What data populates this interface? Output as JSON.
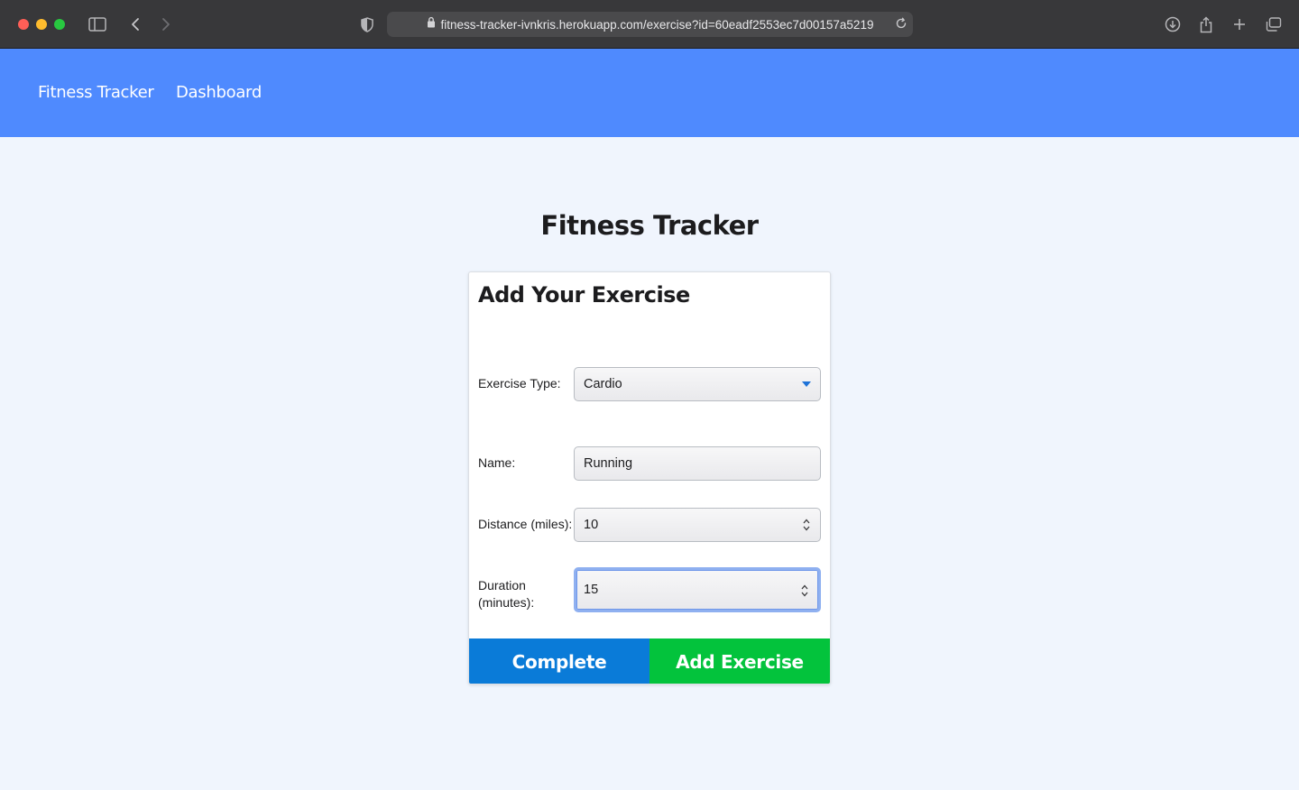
{
  "browser": {
    "url": "fitness-tracker-ivnkris.herokuapp.com/exercise?id=60eadf2553ec7d00157a5219"
  },
  "nav": {
    "brand": "Fitness Tracker",
    "dashboard": "Dashboard"
  },
  "page": {
    "title": "Fitness Tracker"
  },
  "form": {
    "heading": "Add Your Exercise",
    "exercise_type": {
      "label": "Exercise Type:",
      "value": "Cardio"
    },
    "name": {
      "label": "Name:",
      "value": "Running"
    },
    "distance": {
      "label": "Distance (miles):",
      "value": "10"
    },
    "duration": {
      "label_line1": "Duration",
      "label_line2": "(minutes):",
      "value": "15"
    },
    "complete_label": "Complete",
    "add_label": "Add Exercise"
  },
  "colors": {
    "navbar": "#4f8afe",
    "complete_button": "#0a7bd8",
    "add_button": "#03c33c",
    "page_background": "#f0f5fd"
  }
}
